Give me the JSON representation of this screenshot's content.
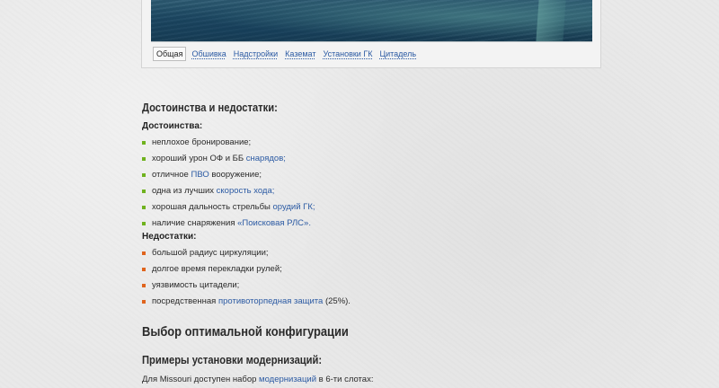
{
  "gallery": {
    "tabs": [
      {
        "label": "Общая",
        "active": true
      },
      {
        "label": "Обшивка",
        "active": false
      },
      {
        "label": "Надстройки",
        "active": false
      },
      {
        "label": "Каземат",
        "active": false
      },
      {
        "label": "Установки ГК",
        "active": false
      },
      {
        "label": "Цитадель",
        "active": false
      }
    ]
  },
  "section_pros_cons": {
    "heading": "Достоинства и недостатки:",
    "pros_label": "Достоинства:",
    "pros": [
      {
        "text": "неплохое бронирование;",
        "link": "",
        "after": ""
      },
      {
        "text": "хороший урон ОФ и ББ ",
        "link": "снарядов;",
        "after": ""
      },
      {
        "text": "отличное ",
        "link": "ПВО",
        "after": " вооружение;"
      },
      {
        "text": "одна из лучших ",
        "link": "скорость хода;",
        "after": ""
      },
      {
        "text": "хорошая дальность стрельбы ",
        "link": "орудий ГК;",
        "after": ""
      },
      {
        "text": "наличие снаряжения ",
        "link": "«Поисковая РЛС».",
        "after": ""
      }
    ],
    "cons_label": "Недостатки:",
    "cons": [
      {
        "text": "большой радиус циркуляции;",
        "link": "",
        "after": ""
      },
      {
        "text": "долгое время перекладки рулей;",
        "link": "",
        "after": ""
      },
      {
        "text": "уязвимость цитадели;",
        "link": "",
        "after": ""
      },
      {
        "text": "посредственная ",
        "link": "противоторпедная защита",
        "after": " (25%)."
      }
    ]
  },
  "section_config": {
    "heading": "Выбор оптимальной конфигурации",
    "subheading": "Примеры установки модернизаций:",
    "para_before": "Для Missouri доступен набор ",
    "para_link": "модернизаций",
    "para_after": " в 6-ти слотах:"
  },
  "colors": {
    "link": "#2b5aa3",
    "pros_bullet": "#6fb21e",
    "cons_bullet": "#e0641d"
  }
}
